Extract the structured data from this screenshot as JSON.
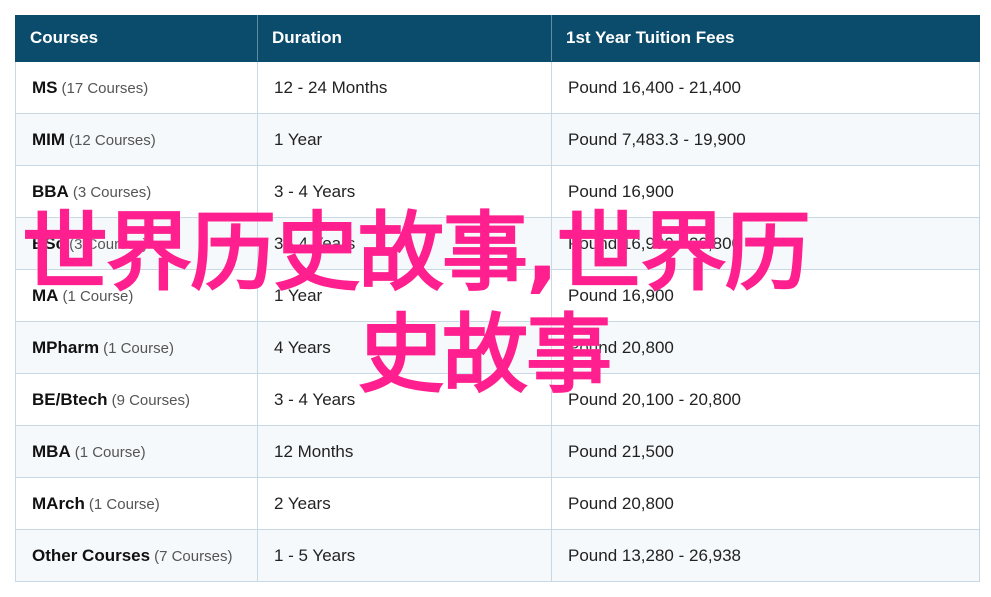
{
  "table": {
    "headers": [
      "Courses",
      "Duration",
      "1st Year Tuition Fees"
    ],
    "rows": [
      {
        "course": "MS",
        "count": "(17 Courses)",
        "duration": "12 - 24 Months",
        "fees": "Pound 16,400 - 21,400"
      },
      {
        "course": "MIM",
        "count": "(12 Courses)",
        "duration": "1 Year",
        "fees": "Pound 7,483.3 - 19,900"
      },
      {
        "course": "BBA",
        "count": "(3 Courses)",
        "duration": "3 - 4 Years",
        "fees": "Pound 16,900"
      },
      {
        "course": "BSc",
        "count": "(3 Courses)",
        "duration": "3 - 4 Years",
        "fees": "Pound 16,900 - 20,800"
      },
      {
        "course": "MA",
        "count": "(1 Course)",
        "duration": "1 Year",
        "fees": "Pound 16,900"
      },
      {
        "course": "MPharm",
        "count": "(1 Course)",
        "duration": "4 Years",
        "fees": "Pound 20,800"
      },
      {
        "course": "BE/Btech",
        "count": "(9 Courses)",
        "duration": "3 - 4 Years",
        "fees": "Pound 20,100 - 20,800"
      },
      {
        "course": "MBA",
        "count": "(1 Course)",
        "duration": "12 Months",
        "fees": "Pound 21,500"
      },
      {
        "course": "MArch",
        "count": "(1 Course)",
        "duration": "2 Years",
        "fees": "Pound 20,800"
      },
      {
        "course": "Other Courses",
        "count": "(7 Courses)",
        "duration": "1 - 5 Years",
        "fees": "Pound 13,280 - 26,938"
      }
    ]
  },
  "overlay": {
    "line1": "世界历史故事,世界历",
    "line2": "史故事",
    "color": "#ff1f8e"
  },
  "colors": {
    "header_bg": "#0b4b6b",
    "header_text": "#ffffff",
    "row_border": "#c9d9e3"
  }
}
